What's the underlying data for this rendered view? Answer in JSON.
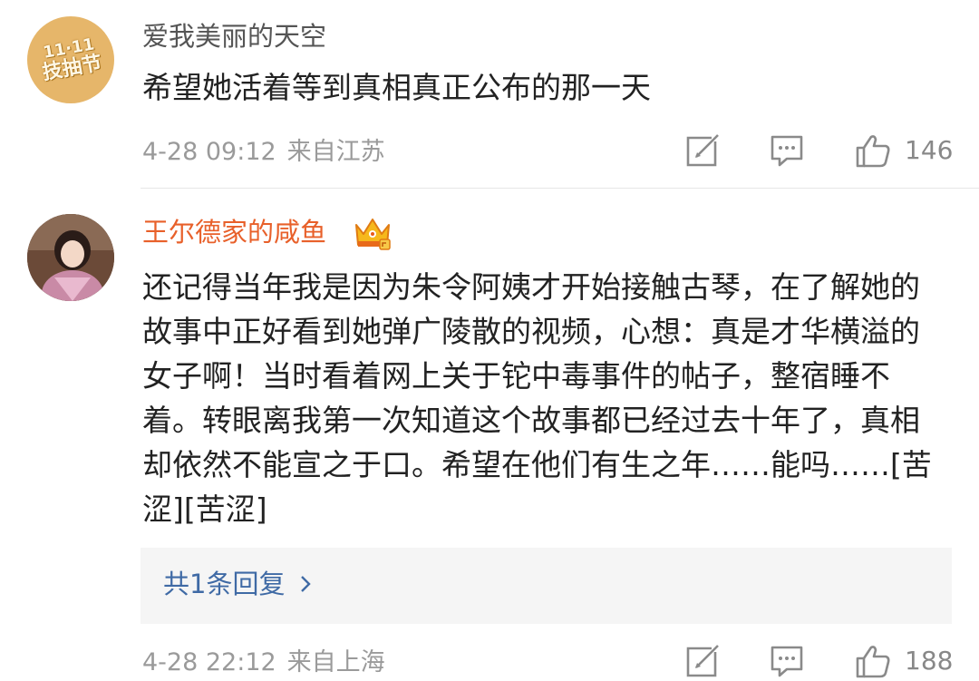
{
  "comments": [
    {
      "avatar_badge": {
        "top": "11·11",
        "bottom": "技抽节"
      },
      "username": "爱我美丽的天空",
      "text": "希望她活着等到真相真正公布的那一天",
      "time": "4-28 09:12",
      "location": "来自江苏",
      "likes": "146"
    },
    {
      "username": "王尔德家的咸鱼",
      "vip_badge_icon": "crown-icon",
      "text": "还记得当年我是因为朱令阿姨才开始接触古琴，在了解她的故事中正好看到她弹广陵散的视频，心想：真是才华横溢的女子啊！当时看着网上关于铊中毒事件的帖子，整宿睡不着。转眼离我第一次知道这个故事都已经过去十年了，真相却依然不能宣之于口。希望在他们有生之年……能吗……[苦涩][苦涩]",
      "replies_label": "共1条回复",
      "time": "4-28 22:12",
      "location": "来自上海",
      "likes": "188"
    }
  ],
  "icons": {
    "share": "share-icon",
    "comment": "comment-icon",
    "like": "thumbs-up-icon",
    "chevron": "chevron-right-icon"
  },
  "colors": {
    "username_normal": "#555555",
    "username_vip": "#e8602a",
    "reply_link": "#3f6aa5",
    "meta": "#9a9a9a"
  }
}
